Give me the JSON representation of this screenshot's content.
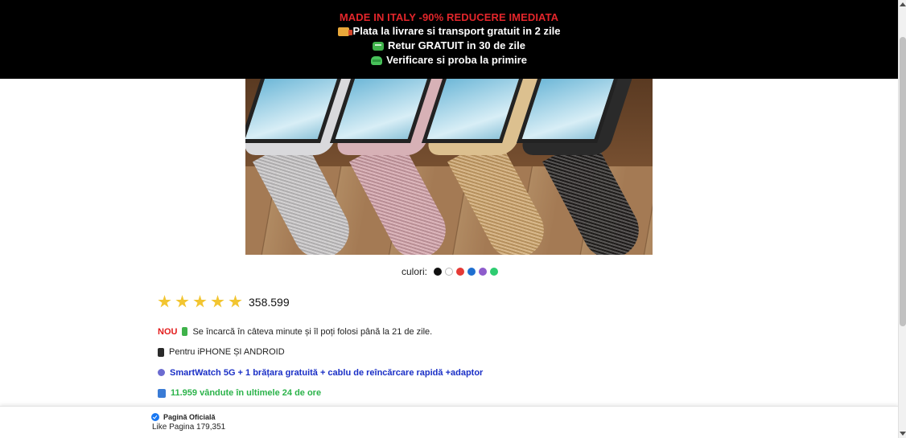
{
  "promo": {
    "headline": "MADE IN ITALY -90% REDUCERE IMEDIATA",
    "lines": [
      {
        "icon": "truck-icon",
        "text": "Plata la livrare si transport gratuit in 2 zile"
      },
      {
        "icon": "return-icon",
        "text": "Retur GRATUIT in 30 de zile"
      },
      {
        "icon": "check-package-icon",
        "text": "Verificare si proba la primire"
      }
    ]
  },
  "product": {
    "colors_label": "culori:",
    "colors": [
      "#111111",
      "#ffffff",
      "#e53935",
      "#1e6fd0",
      "#8e5ccc",
      "#2ecc71"
    ]
  },
  "rating": {
    "stars": 5,
    "count": "358.599"
  },
  "features": {
    "nou_label": "NOU",
    "charge_text": "Se încarcă în câteva minute și îl poți folosi până la 21 de zile.",
    "compat_text": "Pentru iPHONE ȘI ANDROID",
    "bundle_text": "SmartWatch 5G + 1 brățara gratuită + cablu de reîncărcare rapidă +adaptor",
    "sold_text": "11.959 vândute în ultimele 24 de ore"
  },
  "footer": {
    "official_label": "Pagină Oficială",
    "likes_text": "Like Pagina 179,351"
  }
}
